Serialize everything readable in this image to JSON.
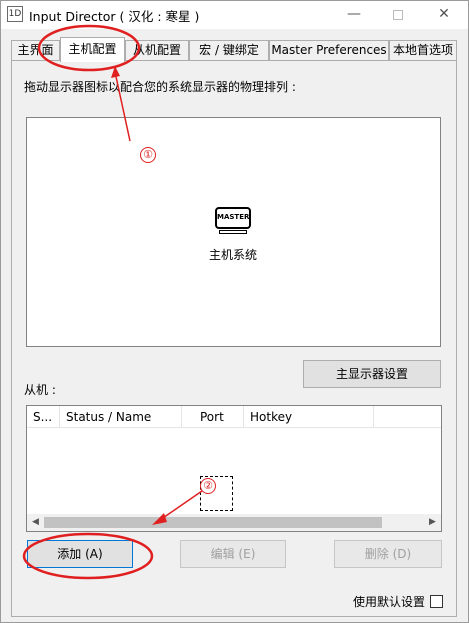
{
  "window": {
    "app_icon_text": "1D",
    "title": "Input Director ( 汉化 : 寒星 )",
    "minimize_glyph": "—",
    "close_glyph": "✕"
  },
  "tabs": [
    {
      "label": "主界面",
      "active": false
    },
    {
      "label": "主机配置",
      "active": true
    },
    {
      "label": "从机配置",
      "active": false
    },
    {
      "label": "宏 / 键绑定",
      "active": false
    },
    {
      "label": "Master Preferences",
      "active": false
    },
    {
      "label": "本地首选项",
      "active": false
    }
  ],
  "master_config": {
    "instruction": "拖动显示器图标以配合您的系统显示器的物理排列 :",
    "monitor_icon_text": "MASTER",
    "monitor_label": "主机系统",
    "master_display_button": "主显示器设置",
    "slaves_label": "从机 :",
    "list_columns": [
      "S...",
      "Status / Name",
      "Port",
      "Hotkey"
    ],
    "add_button": "添加 (A)",
    "edit_button": "编辑 (E)",
    "delete_button": "删除 (D)",
    "use_default_label": "使用默认设置",
    "use_default_checked": false
  },
  "annotations": {
    "marker_1": "①",
    "marker_2": "②",
    "color": "#e02020"
  }
}
